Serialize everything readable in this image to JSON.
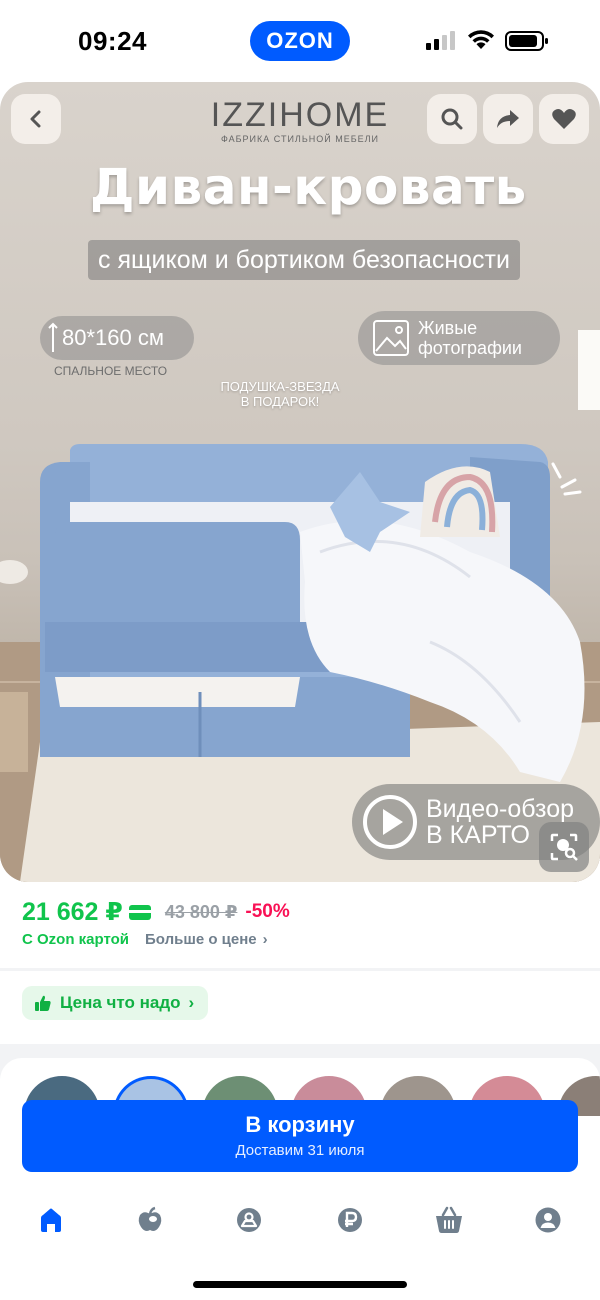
{
  "status_bar": {
    "time": "09:24",
    "app_badge": "OZON"
  },
  "hero": {
    "brand": "IZZIHOME",
    "brand_tagline": "ФАБРИКА СТИЛЬНОЙ МЕБЕЛИ",
    "headline": "Диван-кровать",
    "subheadline": "с ящиком и бортиком безопасности",
    "size_label": "80*160 см",
    "size_caption": "СПАЛЬНОЕ МЕСТО",
    "live_photos_line1": "Живые",
    "live_photos_line2": "фотографии",
    "gift_line1": "ПОДУШКА-ЗВЕЗДА",
    "gift_line2": "В ПОДАРОК!",
    "video_line1": "Видео-обзор",
    "video_line2": "В КАРТО"
  },
  "price": {
    "current": "21 662 ₽",
    "old": "43 800 ₽",
    "discount": "-50%",
    "card_label": "С Ozon картой",
    "more_label": "Больше о цене",
    "chevron": "›"
  },
  "badge": {
    "label": "Цена что надо",
    "chevron": "›"
  },
  "swatches": [
    "#4a6a80",
    "#a9c3e4",
    "#6d8f74",
    "#c98c9a",
    "#9e958d",
    "#d48b96",
    "#8b7f77"
  ],
  "cart": {
    "title": "В корзину",
    "subtitle": "Доставим 31 июля"
  },
  "nav": {
    "items": [
      "home-icon",
      "fresh-icon",
      "bonus-icon",
      "finance-icon",
      "cart-icon",
      "profile-icon"
    ],
    "active_color": "#005bff",
    "inactive_color": "#707f8d"
  },
  "colors": {
    "accent": "#005bff",
    "price_green": "#10c44c",
    "discount_pink": "#f91155"
  }
}
